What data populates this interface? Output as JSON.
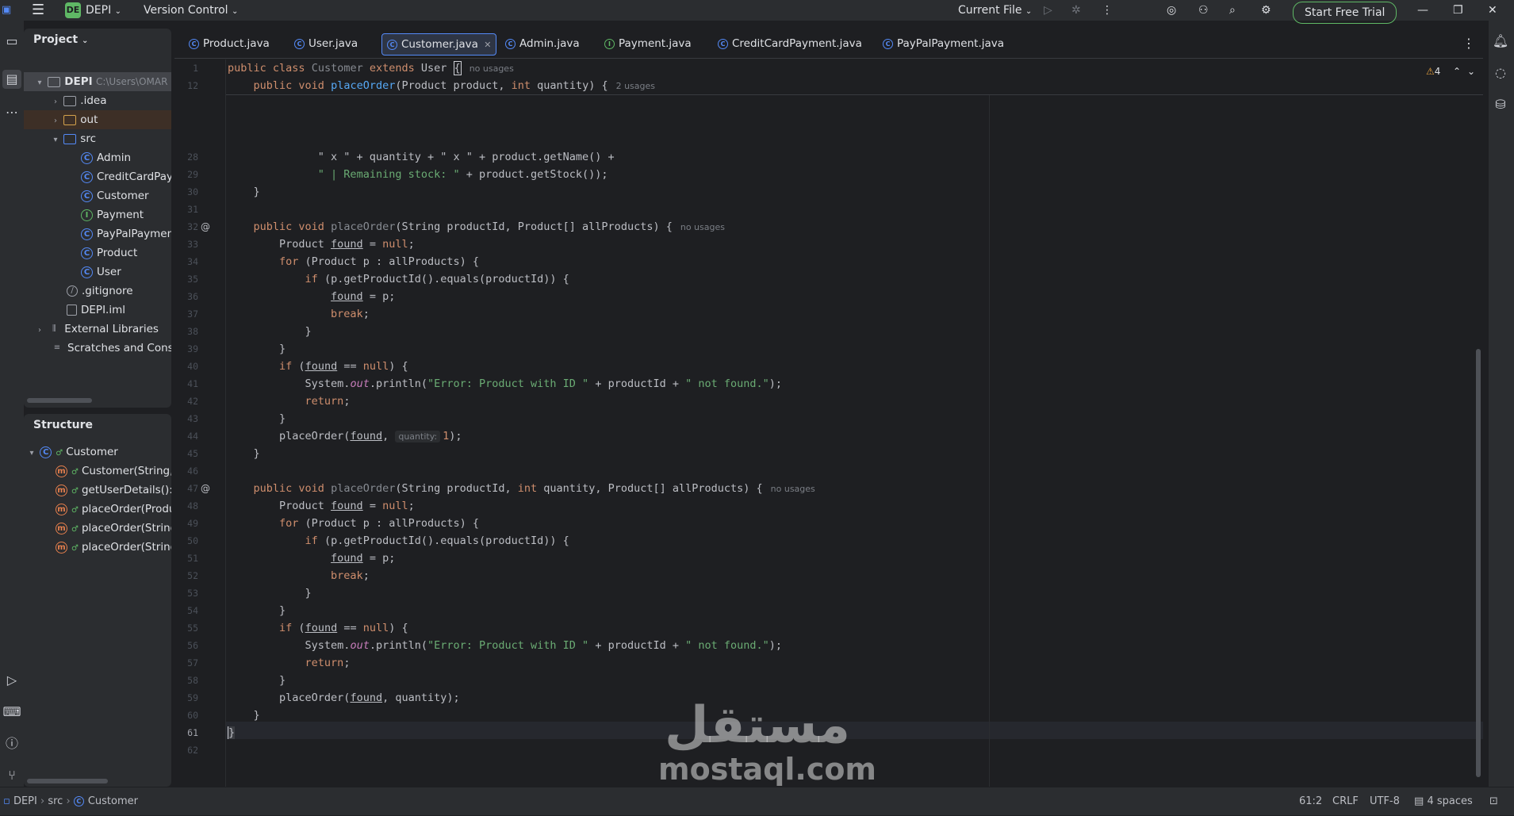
{
  "topbar": {
    "project_badge": "DE",
    "project_name": "DEPI",
    "vcs": "Version Control",
    "run_config": "Current File",
    "trial_button": "Start Free Trial"
  },
  "project_panel": {
    "title": "Project",
    "rows": [
      {
        "label": "DEPI",
        "suffix": "C:\\Users\\OMAR",
        "icon": "folder-icon",
        "arrow": "v"
      },
      {
        "label": ".idea",
        "icon": "folder-icon",
        "arrow": ">"
      },
      {
        "label": "out",
        "icon": "folder-icon",
        "arrow": ">"
      },
      {
        "label": "src",
        "icon": "folder-icon",
        "arrow": "v"
      },
      {
        "label": "Admin",
        "icon": "class-icon"
      },
      {
        "label": "CreditCardPayment",
        "icon": "class-icon"
      },
      {
        "label": "Customer",
        "icon": "class-icon"
      },
      {
        "label": "Payment",
        "icon": "interface-icon"
      },
      {
        "label": "PayPalPayment",
        "icon": "class-icon"
      },
      {
        "label": "Product",
        "icon": "class-icon"
      },
      {
        "label": "User",
        "icon": "class-icon"
      },
      {
        "label": ".gitignore",
        "icon": "ignore-file-icon"
      },
      {
        "label": "DEPI.iml",
        "icon": "module-file-icon"
      },
      {
        "label": "External Libraries",
        "icon": "library-icon",
        "arrow": ">"
      },
      {
        "label": "Scratches and Consoles",
        "icon": "scratches-icon"
      }
    ]
  },
  "structure_panel": {
    "title": "Structure",
    "rows": [
      {
        "label": "Customer",
        "icon": "class-icon"
      },
      {
        "label": "Customer(String, String, String)",
        "icon": "method-icon"
      },
      {
        "label": "getUserDetails(): void",
        "icon": "method-icon"
      },
      {
        "label": "placeOrder(Product, int): void",
        "icon": "method-icon"
      },
      {
        "label": "placeOrder(String, Product[]): void",
        "icon": "method-icon"
      },
      {
        "label": "placeOrder(String, int, Product[]): void",
        "icon": "method-icon"
      }
    ]
  },
  "tabs": [
    {
      "label": "Product.java",
      "active": false
    },
    {
      "label": "User.java",
      "active": false
    },
    {
      "label": "Customer.java",
      "active": true
    },
    {
      "label": "Admin.java",
      "active": false
    },
    {
      "label": "Payment.java",
      "active": false
    },
    {
      "label": "CreditCardPayment.java",
      "active": false
    },
    {
      "label": "PayPalPayment.java",
      "active": false
    }
  ],
  "editor": {
    "warnings_count": "4",
    "hints": {
      "no_usages": "no usages",
      "two_usages": "2 usages",
      "quantity_inlay": "quantity:"
    }
  },
  "statusbar": {
    "breadcrumb": [
      "DEPI",
      "src",
      "Customer"
    ],
    "position": "61:2",
    "line_sep": "CRLF",
    "encoding": "UTF-8",
    "indent": "4 spaces"
  },
  "watermark": {
    "arabic": "مستقل",
    "latin": "mostaql.com"
  }
}
